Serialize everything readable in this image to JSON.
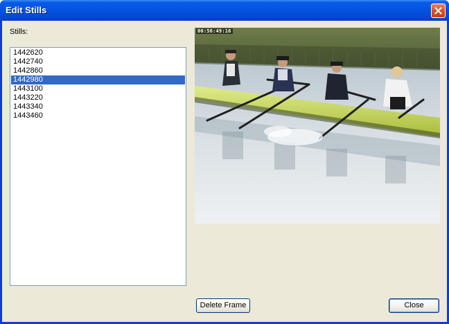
{
  "window": {
    "title": "Edit Stills"
  },
  "stills": {
    "label": "Stills:",
    "items": [
      "1442620",
      "1442740",
      "1442860",
      "1442980",
      "1443100",
      "1443220",
      "1443340",
      "1443460"
    ],
    "selected": "1442980"
  },
  "preview": {
    "timecode": "00:56:49:16"
  },
  "buttons": {
    "delete_label": "Delete Frame",
    "close_label": "Close"
  },
  "colors": {
    "titlebar": "#0453e0",
    "dialog_bg": "#ece9d8",
    "selection": "#316ac5",
    "close_button": "#d9542a"
  }
}
